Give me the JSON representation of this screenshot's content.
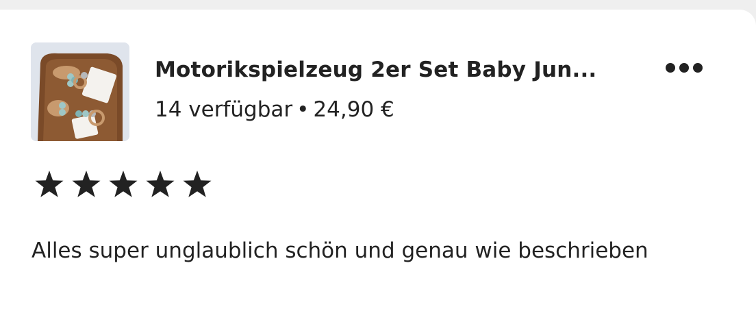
{
  "listing": {
    "title": "Motorikspielzeug 2er Set Baby Jun...",
    "availability": "14 verfügbar",
    "separator": "•",
    "price": "24,90 €",
    "thumbnail_icon": "product-photo-wooden-baby-rattles"
  },
  "menu": {
    "icon": "more-horizontal-icon"
  },
  "rating": {
    "stars": 5,
    "max": 5,
    "icon": "star-icon",
    "color": "#222222"
  },
  "review": {
    "text": "Alles super unglaublich schön und genau wie beschrieben"
  }
}
